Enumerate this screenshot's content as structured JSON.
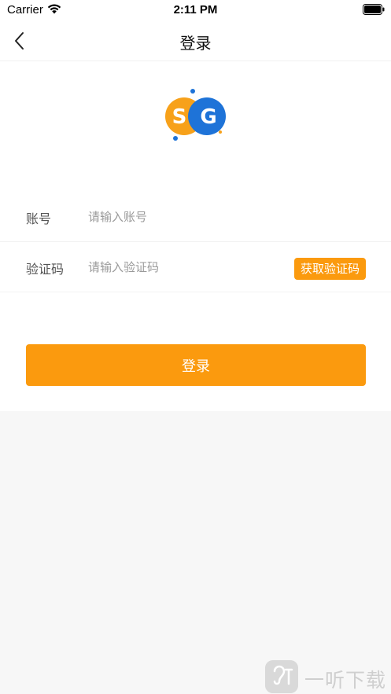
{
  "status_bar": {
    "carrier": "Carrier",
    "time": "2:11 PM"
  },
  "nav": {
    "title": "登录"
  },
  "logo": {
    "letters": "SG",
    "colors": {
      "left_circle": "#f7a11a",
      "right_circle": "#1e73d8",
      "dot": "#1e73d8"
    }
  },
  "form": {
    "account": {
      "label": "账号",
      "placeholder": "请输入账号",
      "value": ""
    },
    "code": {
      "label": "验证码",
      "placeholder": "请输入验证码",
      "value": "",
      "get_code_label": "获取验证码"
    },
    "login_label": "登录"
  },
  "theme": {
    "accent": "#fb9a0e",
    "background": "#f7f7f7"
  },
  "watermark": {
    "icon": "ear-icon",
    "text": "一听下载"
  }
}
